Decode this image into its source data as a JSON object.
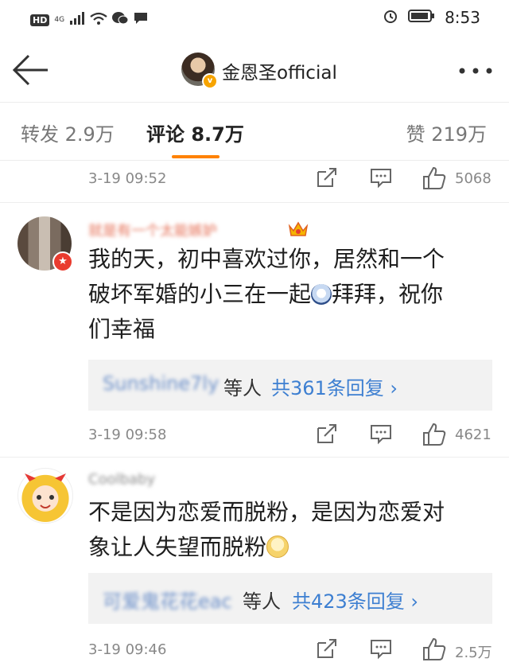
{
  "status_bar": {
    "hd": "HD",
    "network": "4G",
    "time": "8:53",
    "icons": [
      "signal-icon",
      "wifi-icon",
      "chat-bubble-icon",
      "alarm-icon",
      "battery-icon"
    ]
  },
  "header": {
    "title": "金恩圣official",
    "back_icon": "arrow-left-icon",
    "more_icon": "ellipsis-icon",
    "verified_badge": "v"
  },
  "tabs": {
    "repost": "转发 2.9万",
    "comment": "评论 8.7万",
    "like": "赞 219万",
    "active": "comment",
    "accent": "#ff8200"
  },
  "comments": [
    {
      "date": "3-19 09:52",
      "likes": "5068"
    },
    {
      "username": "就是有一个太能嫉妒",
      "badge_icon": "crown-icon",
      "avatar_badge": "★",
      "text_lines": [
        "我的天，初中喜欢过你，居然和一个",
        "破坏军婚的小三在一起",
        "拜拜，祝你",
        "们幸福"
      ],
      "emoji": "scared-emoji-icon",
      "reply_user": "Sunshine7ly",
      "reply_etc": "等人",
      "reply_count": "共361条回复 ›",
      "date": "3-19 09:58",
      "likes": "4621"
    },
    {
      "username": "Coolbaby",
      "text_lines": [
        "不是因为恋爱而脱粉，是因为恋爱对",
        "象让人失望而脱粉"
      ],
      "emoji": "sad-emoji-icon",
      "reply_user": "可爱鬼花花eac",
      "reply_etc": "等人",
      "reply_count": "共423条回复 ›",
      "date": "3-19 09:46",
      "likes": "2.5万"
    }
  ],
  "colors": {
    "link": "#3d7fd1",
    "meta": "#888888",
    "reply_bg": "#f2f2f2"
  }
}
